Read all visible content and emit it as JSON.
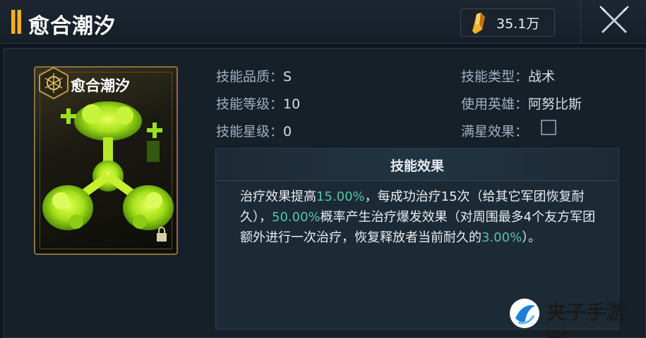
{
  "header": {
    "title": "愈合潮汐",
    "currency_value": "35.1万",
    "currency_icon": "crystal-icon",
    "close_icon": "close-icon"
  },
  "card": {
    "title": "愈合潮汐",
    "emblem_icon": "hexagon-emblem-icon",
    "art": "green-slime-art",
    "lock_icon": "lock-icon"
  },
  "info": {
    "left": [
      {
        "label": "技能品质：",
        "value": "S"
      },
      {
        "label": "技能等级：",
        "value": "10"
      },
      {
        "label": "技能星级：",
        "value": "0"
      }
    ],
    "right": [
      {
        "label": "技能类型：",
        "value": "战术"
      },
      {
        "label": "使用英雄：",
        "value": "阿努比斯"
      },
      {
        "label": "满星效果：",
        "value": ""
      }
    ]
  },
  "effect": {
    "title": "技能效果",
    "parts": [
      {
        "text": "治疗效果提高",
        "highlight": false
      },
      {
        "text": "15.00%",
        "highlight": true
      },
      {
        "text": "，每成功治疗15次（给其它军团恢复耐久），",
        "highlight": false
      },
      {
        "text": "50.00%",
        "highlight": true
      },
      {
        "text": "概率产生治疗爆发效果（对周围最多4个友方军团额外进行一次治疗，恢复释放者当前耐久的",
        "highlight": false
      },
      {
        "text": "3.00%",
        "highlight": true
      },
      {
        "text": "）。",
        "highlight": false
      }
    ]
  },
  "watermark": {
    "title": "夹子手游网",
    "url": "jzguide.com"
  },
  "colors": {
    "accent_gold": "#f1b01e",
    "highlight_green": "#54c6a6",
    "slime_green": "#a6e21a"
  }
}
